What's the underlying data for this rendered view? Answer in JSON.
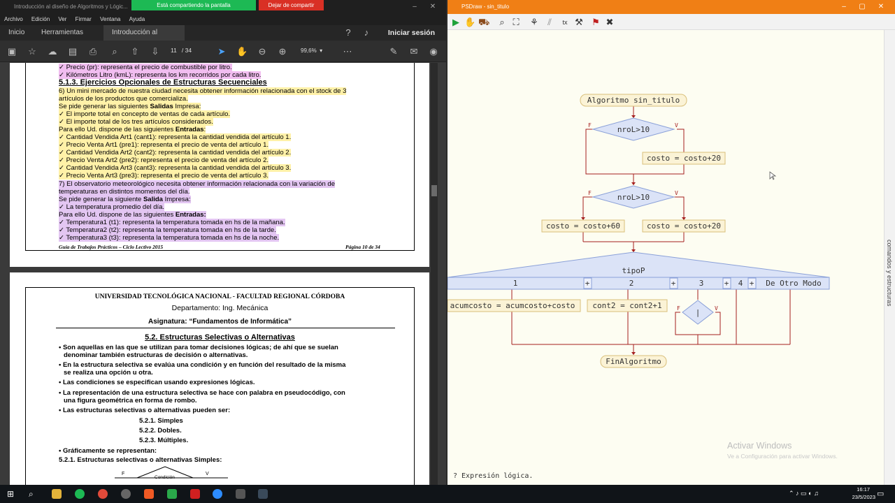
{
  "share": {
    "banner": "Está compartiendo la pantalla",
    "stop": "Dejar de compartir"
  },
  "pdf": {
    "title": "Introducción al diseño de Algoritmos y Lógic...",
    "menu": [
      "Archivo",
      "Edición",
      "Ver",
      "Firmar",
      "Ventana",
      "Ayuda"
    ],
    "tabs": [
      "Inicio",
      "Herramientas",
      "Introducción al dise..."
    ],
    "close_tab": "×",
    "signin": "Iniciar sesión",
    "page_current": "11",
    "page_total": "/ 34",
    "zoom": "99,6%",
    "page1": {
      "l1": "✓ Precio (pr): representa el precio de combustible por litro.",
      "l2": "✓ Kilómetros Litro (kmL): representa los km recorridos por cada litro.",
      "h": "5.1.3. Ejercicios Opcionales de Estructuras Secuenciales",
      "l3": "6) Un mini mercado de nuestra ciudad necesita obtener información relacionada con el stock de 3",
      "l4": "artículos de los productos que comercializa.",
      "l5a": "Se pide generar las siguientes ",
      "l5b": "Salidas",
      " l5c": "",
      "l5c": " Impresa:",
      "l6": "✓ El importe total en concepto de ventas de cada artículo.",
      "l7": "✓ El importe total de los tres artículos considerados.",
      "l8a": "Para ello Ud. dispone de las siguientes ",
      "l8b": "Entradas",
      "l8c": ":",
      "l9": "✓ Cantidad Vendida Art1 (cant1): representa la cantidad vendida del artículo 1.",
      "l10": "✓ Precio Venta Art1 (pre1): representa el precio de venta del artículo 1.",
      "l11": "✓ Cantidad Vendida Art2 (cant2): representa la cantidad vendida del artículo 2.",
      "l12": "✓ Precio Venta Art2 (pre2): representa el precio de venta del artículo 2.",
      "l13": "✓ Cantidad Vendida Art3 (cant3): representa la cantidad vendida del artículo 3.",
      "l14": "✓ Precio Venta Art3 (pre3): representa el precio de venta del artículo 3.",
      "l15": "7) El observatorio meteorológico necesita obtener información relacionada con la variación de",
      "l16": "temperaturas en distintos momentos del día.",
      "l17a": "Se pide generar la siguiente ",
      "l17b": "Salida",
      "l17c": " Impresa:",
      "l18": "✓ La temperatura promedio del día.",
      "l19a": "Para ello Ud. dispone de las siguientes ",
      "l19b": "Entradas:",
      "l20": "✓ Temperatura1 (t1): representa la temperatura tomada en hs de la mañana.",
      "l21": "✓ Temperatura2 (t2): representa la temperatura tomada en hs de la tarde.",
      "l22": "✓ Temperatura3 (t3): representa la temperatura tomada en hs de la noche.",
      "foot_left": "Guía de Trabajos Prácticos – Ciclo Lectivo 2015",
      "foot_right": "Página 10 de 34"
    },
    "page2": {
      "univ": "UNIVERSIDAD TECNOLÓGICA NACIONAL - FACULTAD REGIONAL CÓRDOBA",
      "dept": "Departamento: Ing. Mecánica",
      "subj": "Asignatura: “Fundamentos de Informática”",
      "sect": "5.2. Estructuras Selectivas o Alternativas",
      "b1a": "• Son aquellas en las que se utilizan para tomar decisiones lógicas; de ahí que se suelan",
      "b1b": "denominar también estructuras de decisión o alternativas.",
      "b2a": "• En la estructura selectiva se evalúa una condición y en función del resultado de la misma",
      "b2b": "se realiza una opción u otra.",
      "b3": "• Las condiciones se especifican usando expresiones lógicas.",
      "b4a": "• La representación de una estructura selectiva se hace con palabra en pseudocódigo, con",
      "b4b": "una figura geométrica en forma de rombo.",
      "b5": "• Las estructuras selectivas o alternativas pueden ser:",
      "s1": "5.2.1.  Simples",
      "s2": "5.2.2.  Dobles.",
      "s3": "5.2.3.  Múltiples.",
      "b6": "• Gráficamente se representan:",
      "sub": "5.2.1. Estructuras selectivas o alternativas Simples:",
      "fig_f": "F",
      "fig_v": "V",
      "fig_cond": "Condición"
    }
  },
  "pseint": {
    "title": "PSDraw - sin_titulo",
    "status": "? Expresión lógica.",
    "sidebar": "comandos y estructuras",
    "watermark1": "Activar Windows",
    "watermark2": "Ve a Configuración para activar Windows.",
    "flow": {
      "start": "Algoritmo sin_titulo",
      "cond1": "nroL>10",
      "assign1": "costo = costo+20",
      "cond2": "nroL>10",
      "assign2f": "costo = costo+60",
      "assign2v": "costo = costo+20",
      "switch": "tipoP",
      "case1": "1",
      "case2": "2",
      "case3": "3",
      "case4": "4",
      "default": "De Otro Modo",
      "plus": "+",
      "c1body": "acumcosto = acumcosto+costo",
      "c2body": "cont2 = cont2+1",
      "c3cond": "|",
      "end": "FinAlgoritmo",
      "f": "F",
      "v": "V"
    }
  },
  "taskbar": {
    "time": "16:17",
    "date": "23/5/2023"
  }
}
